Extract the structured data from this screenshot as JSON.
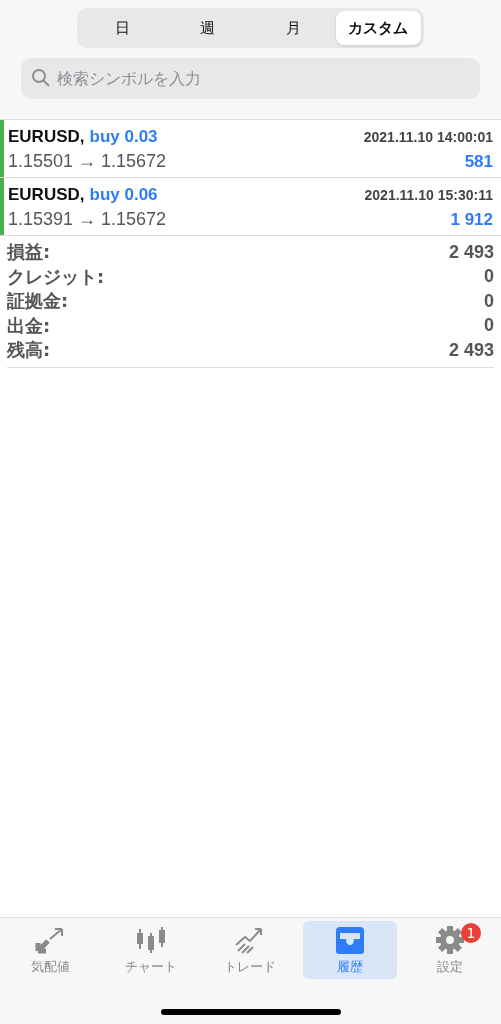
{
  "periods": [
    {
      "label": "日",
      "selected": false
    },
    {
      "label": "週",
      "selected": false
    },
    {
      "label": "月",
      "selected": false
    },
    {
      "label": "カスタム",
      "selected": true
    }
  ],
  "search": {
    "placeholder": "検索シンボルを入力"
  },
  "deals": [
    {
      "symbol": "EURUSD,",
      "side": "buy 0.03",
      "time": "2021.11.10 14:00:01",
      "prices": "1.15501 → 1.15672",
      "profit": "581",
      "color": "#4cae4f"
    },
    {
      "symbol": "EURUSD,",
      "side": "buy 0.06",
      "time": "2021.11.10 15:30:11",
      "prices": "1.15391 → 1.15672",
      "profit": "1 912",
      "color": "#4cae4f"
    }
  ],
  "summary": [
    {
      "label": "損益:",
      "value": "2 493"
    },
    {
      "label": "クレジット:",
      "value": "0"
    },
    {
      "label": "証拠金:",
      "value": "0"
    },
    {
      "label": "出金:",
      "value": "0"
    },
    {
      "label": "残高:",
      "value": "2 493"
    }
  ],
  "tabs": [
    {
      "kind": "quotes",
      "label": "気配値",
      "selected": false
    },
    {
      "kind": "chart",
      "label": "チャート",
      "selected": false
    },
    {
      "kind": "trade",
      "label": "トレード",
      "selected": false
    },
    {
      "kind": "history",
      "label": "履歴",
      "selected": true
    },
    {
      "kind": "settings",
      "label": "設定",
      "selected": false,
      "badge": "1"
    }
  ]
}
